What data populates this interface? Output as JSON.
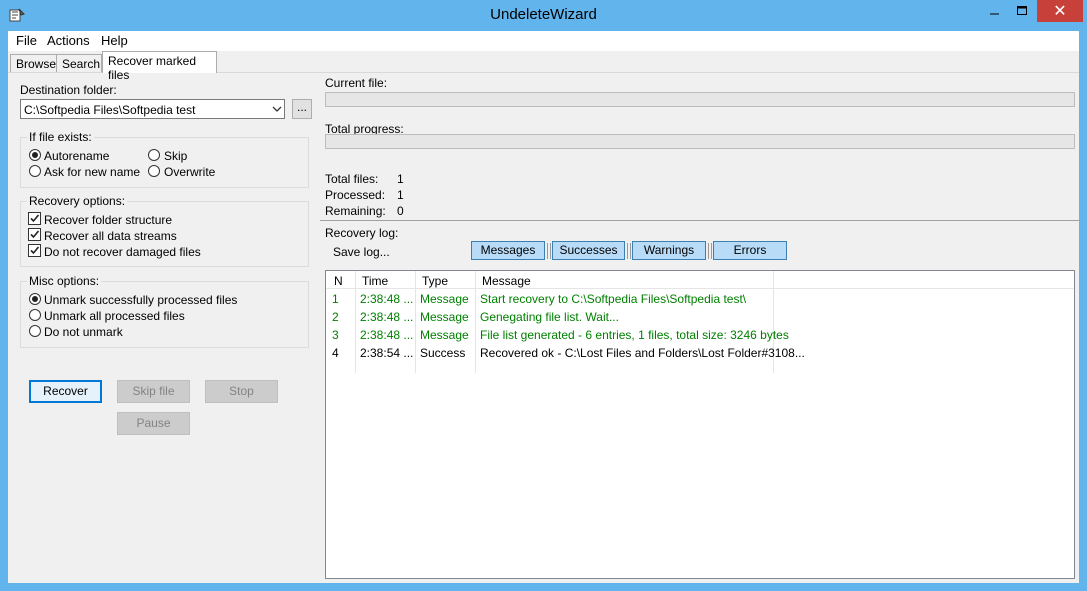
{
  "window": {
    "title": "UndeleteWizard",
    "close_glyph": "✕"
  },
  "menu": {
    "items": [
      "File",
      "Actions",
      "Help"
    ]
  },
  "tabs": [
    "Browse",
    "Search",
    "Recover marked files"
  ],
  "left": {
    "destination_label": "Destination folder:",
    "destination_value": "C:\\Softpedia Files\\Softpedia test",
    "browse_label": "...",
    "if_exists": {
      "title": "If file exists:",
      "options": [
        "Autorename",
        "Skip",
        "Ask for new name",
        "Overwrite"
      ],
      "selected": "Autorename"
    },
    "recovery_options": {
      "title": "Recovery options:",
      "items": [
        "Recover folder structure",
        "Recover all data streams",
        "Do not recover damaged files"
      ]
    },
    "misc_options": {
      "title": "Misc options:",
      "options": [
        "Unmark successfully processed files",
        "Unmark all processed files",
        "Do not unmark"
      ],
      "selected": "Unmark successfully processed files"
    },
    "buttons": {
      "recover": "Recover",
      "skip": "Skip file",
      "stop": "Stop",
      "pause": "Pause"
    }
  },
  "right": {
    "current_file_label": "Current file:",
    "total_progress_label": "Total progress:",
    "stats": [
      {
        "label": "Total files:",
        "value": "1"
      },
      {
        "label": "Processed:",
        "value": "1"
      },
      {
        "label": "Remaining:",
        "value": "0"
      }
    ],
    "recovery_log_label": "Recovery log:",
    "save_log": "Save log...",
    "filters": [
      "Messages",
      "Successes",
      "Warnings",
      "Errors"
    ],
    "log": {
      "columns": [
        "N",
        "Time",
        "Type",
        "Message"
      ],
      "rows": [
        {
          "n": "1",
          "time": "2:38:48 ...",
          "type": "Message",
          "message": "Start recovery to C:\\Softpedia Files\\Softpedia test\\"
        },
        {
          "n": "2",
          "time": "2:38:48 ...",
          "type": "Message",
          "message": "Genegating file list. Wait..."
        },
        {
          "n": "3",
          "time": "2:38:48 ...",
          "type": "Message",
          "message": "File list generated - 6 entries, 1 files, total size: 3246 bytes"
        },
        {
          "n": "4",
          "time": "2:38:54 ...",
          "type": "Success",
          "message": "Recovered ok - C:\\Lost Files and Folders\\Lost Folder#3108..."
        }
      ]
    }
  },
  "colors": {
    "title_bar": "#62b4ec",
    "message_text": "#008000",
    "filter_bg": "#b8dcf8",
    "close_button": "#c7403a"
  }
}
